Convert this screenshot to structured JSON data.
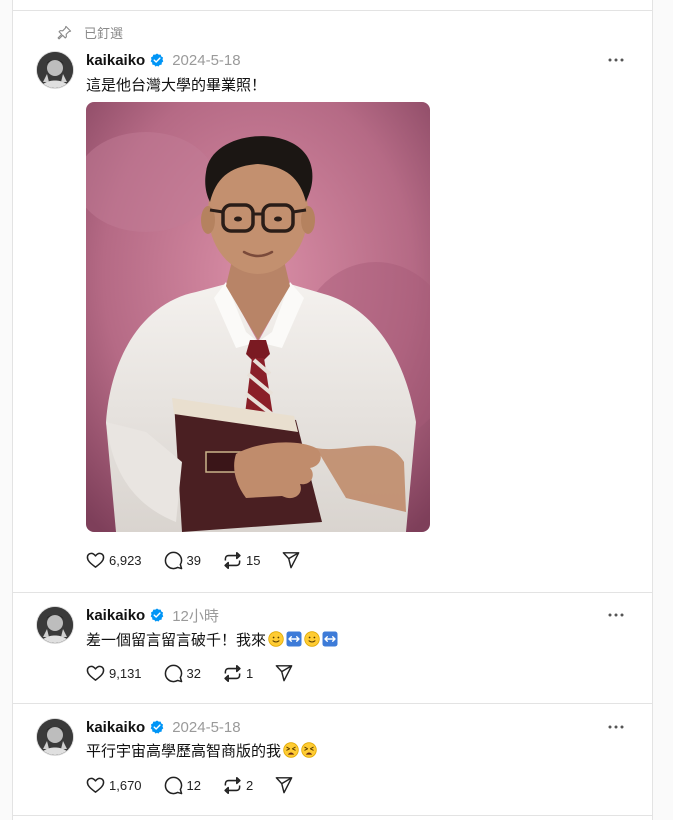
{
  "pinned": {
    "label": "已釘選"
  },
  "posts": [
    {
      "username": "kaikaiko",
      "timestamp": "2024-5-18",
      "text": "這是他台灣大學的畢業照！",
      "stats": {
        "likes": "6,923",
        "replies": "39",
        "reposts": "15"
      }
    },
    {
      "username": "kaikaiko",
      "timestamp": "12小時",
      "text": "差一個留言留言破千！我來",
      "emojis": [
        "slightly-smiling-face",
        "left-right-arrow",
        "slightly-smiling-face",
        "left-right-arrow"
      ],
      "stats": {
        "likes": "9,131",
        "replies": "32",
        "reposts": "1"
      }
    },
    {
      "username": "kaikaiko",
      "timestamp": "2024-5-18",
      "text": "平行宇宙高學歷高智商版的我",
      "emojis": [
        "tired-face",
        "tired-face"
      ],
      "stats": {
        "likes": "1,670",
        "replies": "12",
        "reposts": "2"
      }
    }
  ],
  "colors": {
    "verified": "#0095f6",
    "divider": "#e3e3e3",
    "muted": "#9a9a9a"
  }
}
